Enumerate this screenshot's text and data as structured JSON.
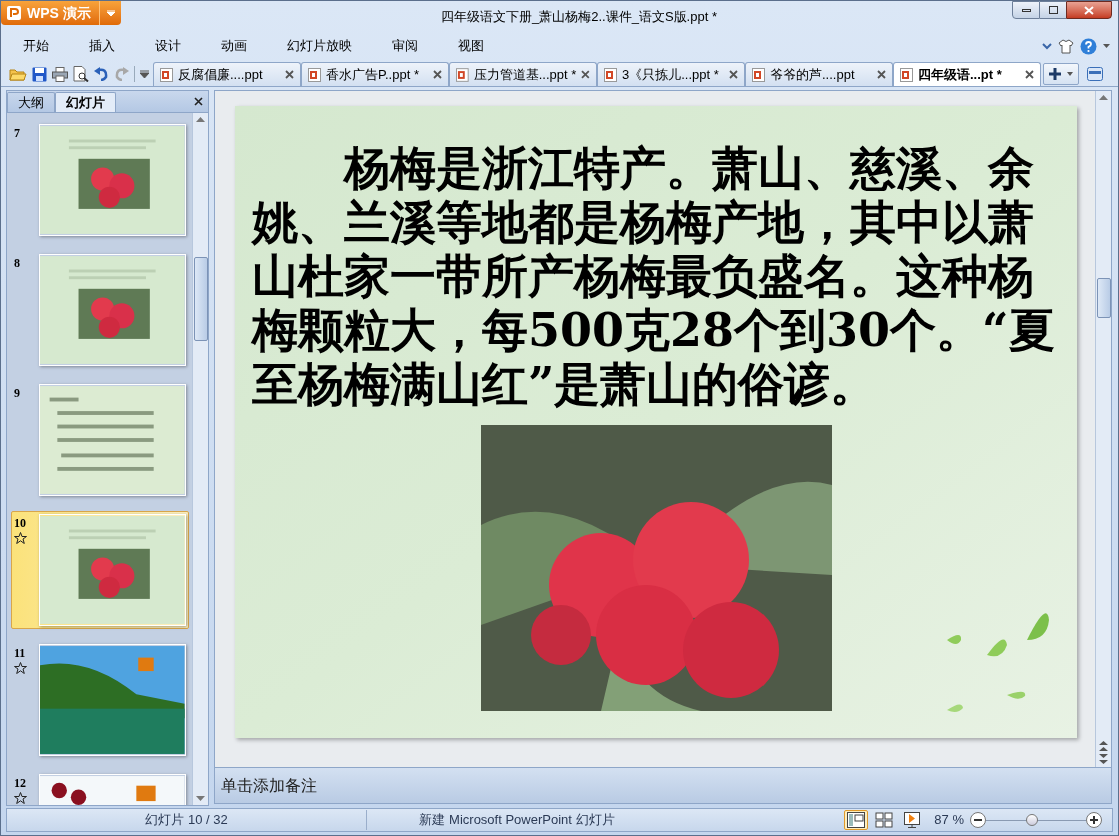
{
  "app_button": {
    "label": "WPS 演示"
  },
  "window": {
    "title": "四年级语文下册_萧山杨梅2..课件_语文S版.ppt *"
  },
  "menu": [
    {
      "label": "开始",
      "selected": false
    },
    {
      "label": "插入",
      "selected": false
    },
    {
      "label": "设计",
      "selected": false
    },
    {
      "label": "动画",
      "selected": false
    },
    {
      "label": "幻灯片放映",
      "selected": false
    },
    {
      "label": "审阅",
      "selected": false
    },
    {
      "label": "视图",
      "selected": false
    }
  ],
  "doc_tabs": [
    {
      "label": "反腐倡廉....ppt",
      "selected": false
    },
    {
      "label": "香水广告P..ppt *",
      "selected": false
    },
    {
      "label": "压力管道基...ppt *",
      "selected": false
    },
    {
      "label": "3《只拣儿...ppt *",
      "selected": false
    },
    {
      "label": "爷爷的芦....ppt",
      "selected": false
    },
    {
      "label": "四年级语...pt *",
      "selected": true
    }
  ],
  "panel_tabs": [
    {
      "label": "大纲",
      "selected": false
    },
    {
      "label": "幻灯片",
      "selected": true
    }
  ],
  "thumbnails": [
    {
      "number": "7",
      "animated": false,
      "selected": false,
      "kind": "fruit"
    },
    {
      "number": "8",
      "animated": false,
      "selected": false,
      "kind": "fruit"
    },
    {
      "number": "9",
      "animated": false,
      "selected": false,
      "kind": "text"
    },
    {
      "number": "10",
      "animated": true,
      "selected": true,
      "kind": "fruit"
    },
    {
      "number": "11",
      "animated": true,
      "selected": false,
      "kind": "lake"
    },
    {
      "number": "12",
      "animated": true,
      "selected": false,
      "kind": "hill"
    }
  ],
  "slide": {
    "text": "杨梅是浙江特产。萧山、慈溪、余姚、兰溪等地都是杨梅产地，其中以萧山杜家一带所产杨梅最负盛名。这种杨梅颗粒大，每500克28个到30个。“夏至杨梅满山红”是萧山的俗谚。"
  },
  "notes": {
    "placeholder": "单击添加备注"
  },
  "status_bar": {
    "slide_counter": "幻灯片 10 / 32",
    "template": "新建 Microsoft PowerPoint 幻灯片",
    "views": [
      {
        "kind": "normal",
        "selected": true
      },
      {
        "kind": "sorter",
        "selected": false
      },
      {
        "kind": "show",
        "selected": false
      }
    ],
    "zoom": "87 %",
    "zoom_slider": {
      "level": 0.45
    }
  }
}
